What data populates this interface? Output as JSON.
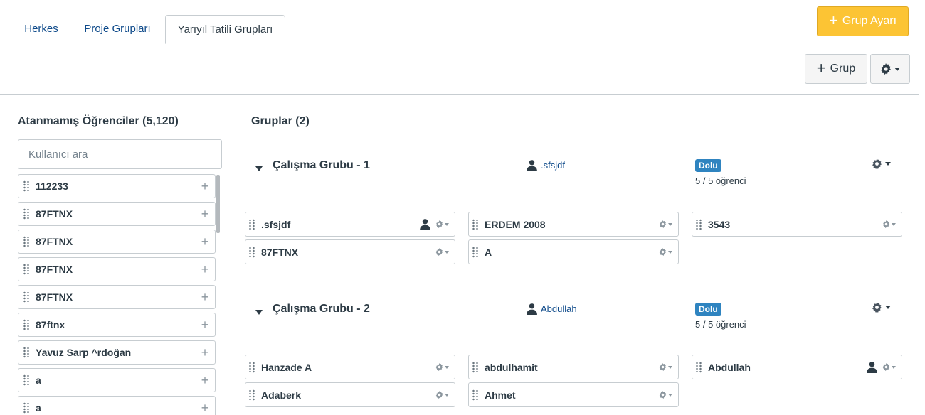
{
  "tabs": [
    {
      "label": "Herkes"
    },
    {
      "label": "Proje Grupları"
    },
    {
      "label": "Yarıyıl Tatili Grupları"
    }
  ],
  "header": {
    "group_settings_label": "Grup Ayarı",
    "add_group_label": "Grup"
  },
  "unassigned": {
    "title": "Atanmamış Öğrenciler (5,120)",
    "search_placeholder": "Kullanıcı ara",
    "students": [
      {
        "name": "112233"
      },
      {
        "name": "87FTNX"
      },
      {
        "name": "87FTNX"
      },
      {
        "name": "87FTNX"
      },
      {
        "name": "87FTNX"
      },
      {
        "name": "87ftnx"
      },
      {
        "name": "Yavuz Sarp ^rdoğan"
      },
      {
        "name": "a"
      },
      {
        "name": "a"
      }
    ]
  },
  "groups_section": {
    "title": "Gruplar (2)"
  },
  "groups": [
    {
      "name": "Çalışma Grubu - 1",
      "leader": ".sfsjdf",
      "badge": "Dolu",
      "count": "5 / 5 öğrenci",
      "members": [
        ".sfsjdf",
        "ERDEM 2008",
        "3543",
        "87FTNX",
        "A"
      ]
    },
    {
      "name": "Çalışma Grubu - 2",
      "leader": "Abdullah",
      "badge": "Dolu",
      "count": "5 / 5 öğrenci",
      "members": [
        "Hanzade A",
        "abdulhamit",
        "Abdullah",
        "Adaberk",
        "Ahmet"
      ]
    }
  ],
  "colors": {
    "accent": "#fcc434",
    "link": "#0e4a8a",
    "badge": "#2f84c0"
  }
}
